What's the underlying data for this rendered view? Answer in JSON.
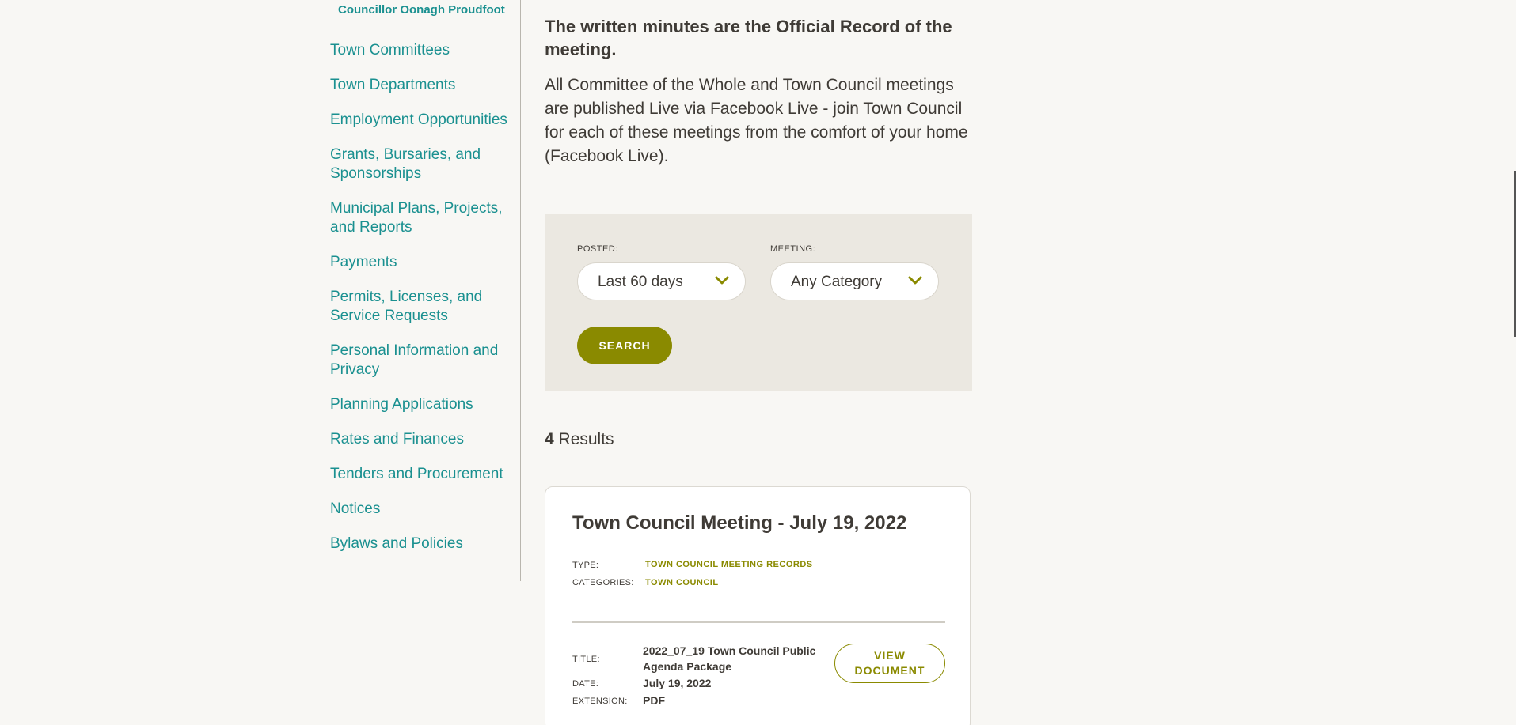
{
  "sidebar": {
    "sub_item": "Councillor Oonagh Proudfoot",
    "items": [
      {
        "label": "Town Committees"
      },
      {
        "label": "Town Departments"
      },
      {
        "label": "Employment Opportunities"
      },
      {
        "label": "Grants, Bursaries, and Sponsorships"
      },
      {
        "label": "Municipal Plans, Projects, and Reports"
      },
      {
        "label": "Payments"
      },
      {
        "label": "Permits, Licenses, and Service Requests"
      },
      {
        "label": "Personal Information and Privacy"
      },
      {
        "label": "Planning Applications"
      },
      {
        "label": "Rates and Finances"
      },
      {
        "label": "Tenders and Procurement"
      },
      {
        "label": "Notices"
      },
      {
        "label": "Bylaws and Policies"
      }
    ]
  },
  "intro": {
    "bold_text": "The written minutes are the Official Record of the meeting.",
    "body_text": "All Committee of the Whole and Town Council meetings are published Live via Facebook Live - join Town Council for each of these meetings from the comfort of your home (Facebook Live)."
  },
  "filters": {
    "posted_label": "POSTED:",
    "posted_value": "Last 60 days",
    "meeting_label": "MEETING:",
    "meeting_value": "Any Category",
    "search_label": "SEARCH"
  },
  "results": {
    "count": "4",
    "label": "Results"
  },
  "card": {
    "title": "Town Council Meeting - July 19, 2022",
    "type_label": "TYPE:",
    "type_value": "TOWN COUNCIL MEETING RECORDS",
    "categories_label": "CATEGORIES:",
    "categories_value": "TOWN COUNCIL",
    "doc_title_label": "TITLE:",
    "doc_title_value": "2022_07_19 Town Council Public Agenda Package",
    "date_label": "DATE:",
    "date_value": "July 19, 2022",
    "extension_label": "EXTENSION:",
    "extension_value": "PDF",
    "view_label": "VIEW DOCUMENT"
  },
  "colors": {
    "link_teal": "#1a9090",
    "accent_olive": "#8a8a00",
    "background": "#f8f7f4",
    "filter_bg": "#ebe8e1"
  }
}
